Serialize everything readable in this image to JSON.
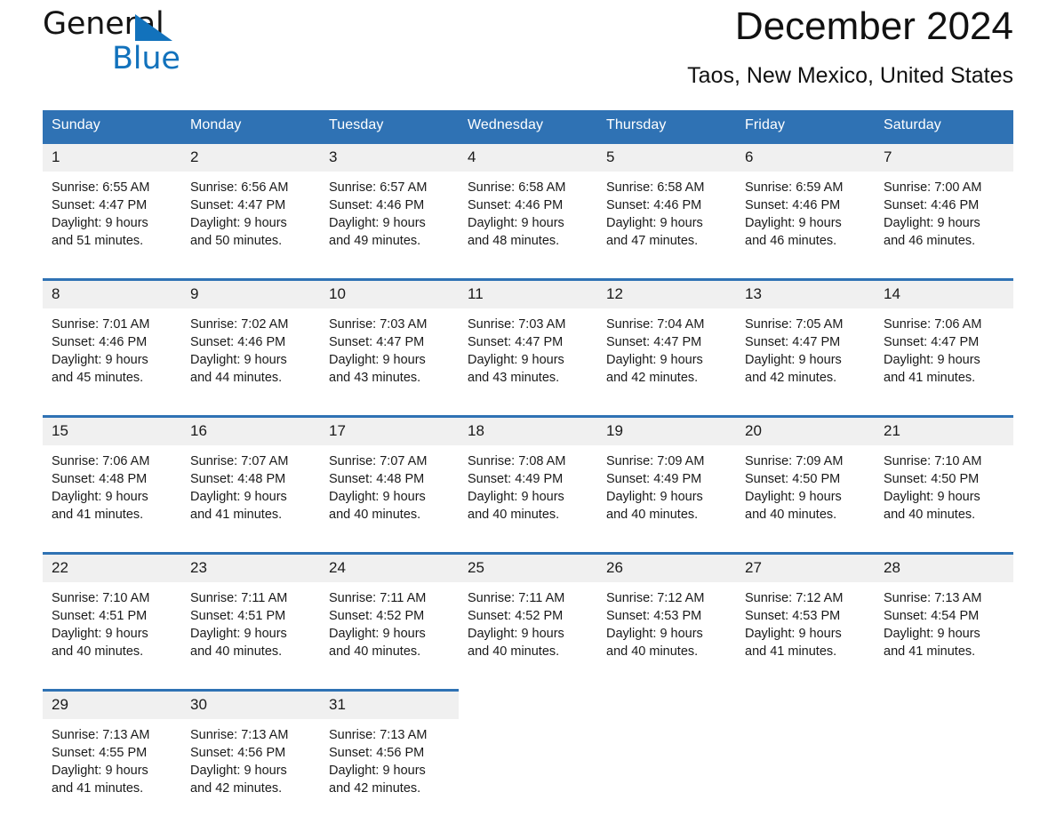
{
  "brand": {
    "name_line1": "General",
    "name_line2": "Blue",
    "triangle_color": "#1272bc"
  },
  "header": {
    "title": "December 2024",
    "subtitle": "Taos, New Mexico, United States",
    "accent_color": "#2f72b4",
    "daynum_band_color": "#f0f0f0"
  },
  "calendar": {
    "weekday_headers": [
      "Sunday",
      "Monday",
      "Tuesday",
      "Wednesday",
      "Thursday",
      "Friday",
      "Saturday"
    ],
    "labels": {
      "sunrise_prefix": "Sunrise: ",
      "sunset_prefix": "Sunset: ",
      "daylight_prefix": "Daylight: "
    },
    "weeks": [
      [
        {
          "day": "1",
          "sunrise": "Sunrise: 6:55 AM",
          "sunset": "Sunset: 4:47 PM",
          "daylight_line1": "Daylight: 9 hours",
          "daylight_line2": "and 51 minutes."
        },
        {
          "day": "2",
          "sunrise": "Sunrise: 6:56 AM",
          "sunset": "Sunset: 4:47 PM",
          "daylight_line1": "Daylight: 9 hours",
          "daylight_line2": "and 50 minutes."
        },
        {
          "day": "3",
          "sunrise": "Sunrise: 6:57 AM",
          "sunset": "Sunset: 4:46 PM",
          "daylight_line1": "Daylight: 9 hours",
          "daylight_line2": "and 49 minutes."
        },
        {
          "day": "4",
          "sunrise": "Sunrise: 6:58 AM",
          "sunset": "Sunset: 4:46 PM",
          "daylight_line1": "Daylight: 9 hours",
          "daylight_line2": "and 48 minutes."
        },
        {
          "day": "5",
          "sunrise": "Sunrise: 6:58 AM",
          "sunset": "Sunset: 4:46 PM",
          "daylight_line1": "Daylight: 9 hours",
          "daylight_line2": "and 47 minutes."
        },
        {
          "day": "6",
          "sunrise": "Sunrise: 6:59 AM",
          "sunset": "Sunset: 4:46 PM",
          "daylight_line1": "Daylight: 9 hours",
          "daylight_line2": "and 46 minutes."
        },
        {
          "day": "7",
          "sunrise": "Sunrise: 7:00 AM",
          "sunset": "Sunset: 4:46 PM",
          "daylight_line1": "Daylight: 9 hours",
          "daylight_line2": "and 46 minutes."
        }
      ],
      [
        {
          "day": "8",
          "sunrise": "Sunrise: 7:01 AM",
          "sunset": "Sunset: 4:46 PM",
          "daylight_line1": "Daylight: 9 hours",
          "daylight_line2": "and 45 minutes."
        },
        {
          "day": "9",
          "sunrise": "Sunrise: 7:02 AM",
          "sunset": "Sunset: 4:46 PM",
          "daylight_line1": "Daylight: 9 hours",
          "daylight_line2": "and 44 minutes."
        },
        {
          "day": "10",
          "sunrise": "Sunrise: 7:03 AM",
          "sunset": "Sunset: 4:47 PM",
          "daylight_line1": "Daylight: 9 hours",
          "daylight_line2": "and 43 minutes."
        },
        {
          "day": "11",
          "sunrise": "Sunrise: 7:03 AM",
          "sunset": "Sunset: 4:47 PM",
          "daylight_line1": "Daylight: 9 hours",
          "daylight_line2": "and 43 minutes."
        },
        {
          "day": "12",
          "sunrise": "Sunrise: 7:04 AM",
          "sunset": "Sunset: 4:47 PM",
          "daylight_line1": "Daylight: 9 hours",
          "daylight_line2": "and 42 minutes."
        },
        {
          "day": "13",
          "sunrise": "Sunrise: 7:05 AM",
          "sunset": "Sunset: 4:47 PM",
          "daylight_line1": "Daylight: 9 hours",
          "daylight_line2": "and 42 minutes."
        },
        {
          "day": "14",
          "sunrise": "Sunrise: 7:06 AM",
          "sunset": "Sunset: 4:47 PM",
          "daylight_line1": "Daylight: 9 hours",
          "daylight_line2": "and 41 minutes."
        }
      ],
      [
        {
          "day": "15",
          "sunrise": "Sunrise: 7:06 AM",
          "sunset": "Sunset: 4:48 PM",
          "daylight_line1": "Daylight: 9 hours",
          "daylight_line2": "and 41 minutes."
        },
        {
          "day": "16",
          "sunrise": "Sunrise: 7:07 AM",
          "sunset": "Sunset: 4:48 PM",
          "daylight_line1": "Daylight: 9 hours",
          "daylight_line2": "and 41 minutes."
        },
        {
          "day": "17",
          "sunrise": "Sunrise: 7:07 AM",
          "sunset": "Sunset: 4:48 PM",
          "daylight_line1": "Daylight: 9 hours",
          "daylight_line2": "and 40 minutes."
        },
        {
          "day": "18",
          "sunrise": "Sunrise: 7:08 AM",
          "sunset": "Sunset: 4:49 PM",
          "daylight_line1": "Daylight: 9 hours",
          "daylight_line2": "and 40 minutes."
        },
        {
          "day": "19",
          "sunrise": "Sunrise: 7:09 AM",
          "sunset": "Sunset: 4:49 PM",
          "daylight_line1": "Daylight: 9 hours",
          "daylight_line2": "and 40 minutes."
        },
        {
          "day": "20",
          "sunrise": "Sunrise: 7:09 AM",
          "sunset": "Sunset: 4:50 PM",
          "daylight_line1": "Daylight: 9 hours",
          "daylight_line2": "and 40 minutes."
        },
        {
          "day": "21",
          "sunrise": "Sunrise: 7:10 AM",
          "sunset": "Sunset: 4:50 PM",
          "daylight_line1": "Daylight: 9 hours",
          "daylight_line2": "and 40 minutes."
        }
      ],
      [
        {
          "day": "22",
          "sunrise": "Sunrise: 7:10 AM",
          "sunset": "Sunset: 4:51 PM",
          "daylight_line1": "Daylight: 9 hours",
          "daylight_line2": "and 40 minutes."
        },
        {
          "day": "23",
          "sunrise": "Sunrise: 7:11 AM",
          "sunset": "Sunset: 4:51 PM",
          "daylight_line1": "Daylight: 9 hours",
          "daylight_line2": "and 40 minutes."
        },
        {
          "day": "24",
          "sunrise": "Sunrise: 7:11 AM",
          "sunset": "Sunset: 4:52 PM",
          "daylight_line1": "Daylight: 9 hours",
          "daylight_line2": "and 40 minutes."
        },
        {
          "day": "25",
          "sunrise": "Sunrise: 7:11 AM",
          "sunset": "Sunset: 4:52 PM",
          "daylight_line1": "Daylight: 9 hours",
          "daylight_line2": "and 40 minutes."
        },
        {
          "day": "26",
          "sunrise": "Sunrise: 7:12 AM",
          "sunset": "Sunset: 4:53 PM",
          "daylight_line1": "Daylight: 9 hours",
          "daylight_line2": "and 40 minutes."
        },
        {
          "day": "27",
          "sunrise": "Sunrise: 7:12 AM",
          "sunset": "Sunset: 4:53 PM",
          "daylight_line1": "Daylight: 9 hours",
          "daylight_line2": "and 41 minutes."
        },
        {
          "day": "28",
          "sunrise": "Sunrise: 7:13 AM",
          "sunset": "Sunset: 4:54 PM",
          "daylight_line1": "Daylight: 9 hours",
          "daylight_line2": "and 41 minutes."
        }
      ],
      [
        {
          "day": "29",
          "sunrise": "Sunrise: 7:13 AM",
          "sunset": "Sunset: 4:55 PM",
          "daylight_line1": "Daylight: 9 hours",
          "daylight_line2": "and 41 minutes."
        },
        {
          "day": "30",
          "sunrise": "Sunrise: 7:13 AM",
          "sunset": "Sunset: 4:56 PM",
          "daylight_line1": "Daylight: 9 hours",
          "daylight_line2": "and 42 minutes."
        },
        {
          "day": "31",
          "sunrise": "Sunrise: 7:13 AM",
          "sunset": "Sunset: 4:56 PM",
          "daylight_line1": "Daylight: 9 hours",
          "daylight_line2": "and 42 minutes."
        },
        null,
        null,
        null,
        null
      ]
    ]
  }
}
